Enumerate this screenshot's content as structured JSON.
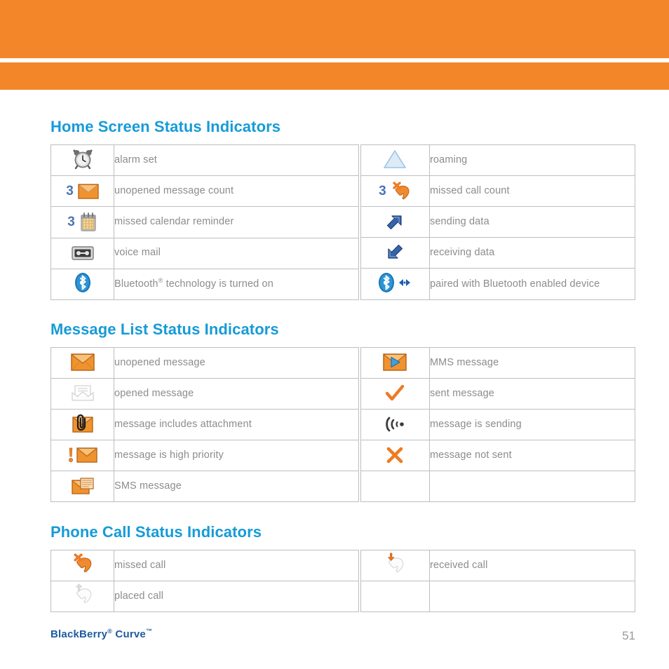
{
  "header": {
    "band_color": "#f28629",
    "bands": [
      "orange-band-top",
      "orange-band-bottom"
    ]
  },
  "theme": {
    "heading_blue": "#169bd7",
    "label_gray": "#8c8c8c",
    "border_gray": "#bcbec0",
    "accent_orange": "#f28629",
    "count_blue": "#4a74b4",
    "brand_blue": "#1d5b9e"
  },
  "sections": [
    {
      "id": "home",
      "heading": "Home Screen Status Indicators",
      "left_rows": [
        {
          "icon": "alarm-clock-icon",
          "count": "",
          "label": "alarm set"
        },
        {
          "icon": "envelope-orange-icon",
          "count": "3",
          "label": "unopened message count"
        },
        {
          "icon": "calendar-icon",
          "count": "3",
          "label": "missed calendar reminder"
        },
        {
          "icon": "voice-mail-icon",
          "count": "",
          "label": "voice mail"
        },
        {
          "icon": "bluetooth-icon",
          "count": "",
          "label": "Bluetooth",
          "label_sup": "®",
          "label_tail": " technology is turned on"
        }
      ],
      "right_rows": [
        {
          "icon": "roaming-triangle-icon",
          "count": "",
          "label": "roaming"
        },
        {
          "icon": "missed-call-icon",
          "count": "3",
          "label": "missed call count"
        },
        {
          "icon": "arrow-up-right-icon",
          "count": "",
          "label": "sending data"
        },
        {
          "icon": "arrow-down-left-icon",
          "count": "",
          "label": "receiving data"
        },
        {
          "icon": "bluetooth-paired-icon",
          "count": "",
          "label": "paired with Bluetooth enabled device"
        }
      ]
    },
    {
      "id": "message",
      "heading": "Message List Status Indicators",
      "left_rows": [
        {
          "icon": "envelope-orange-icon",
          "count": "",
          "label": "unopened message"
        },
        {
          "icon": "envelope-open-gray-icon",
          "count": "",
          "label": "opened message"
        },
        {
          "icon": "envelope-paperclip-icon",
          "count": "",
          "label": "message includes attachment"
        },
        {
          "icon": "envelope-exclamation-icon",
          "count": "",
          "label": "message is high priority"
        },
        {
          "icon": "sms-message-icon",
          "count": "",
          "label": "SMS message"
        }
      ],
      "right_rows": [
        {
          "icon": "mms-message-icon",
          "count": "",
          "label": "MMS message"
        },
        {
          "icon": "orange-check-icon",
          "count": "",
          "label": "sent message"
        },
        {
          "icon": "sending-waves-icon",
          "count": "",
          "label": "message is sending"
        },
        {
          "icon": "orange-x-icon",
          "count": "",
          "label": "message not sent"
        },
        {
          "icon": "",
          "count": "",
          "label": ""
        }
      ]
    },
    {
      "id": "phone",
      "heading": "Phone Call Status Indicators",
      "left_rows": [
        {
          "icon": "missed-call-icon",
          "count": "",
          "label": "missed call"
        },
        {
          "icon": "placed-call-icon",
          "count": "",
          "label": "placed call"
        }
      ],
      "right_rows": [
        {
          "icon": "received-call-icon",
          "count": "",
          "label": "received call"
        },
        {
          "icon": "",
          "count": "",
          "label": ""
        }
      ]
    }
  ],
  "footer": {
    "brand_text": "BlackBerry",
    "brand_sup1": "®",
    "brand_mid": " Curve",
    "brand_sup2": "™",
    "page_number": "51"
  }
}
